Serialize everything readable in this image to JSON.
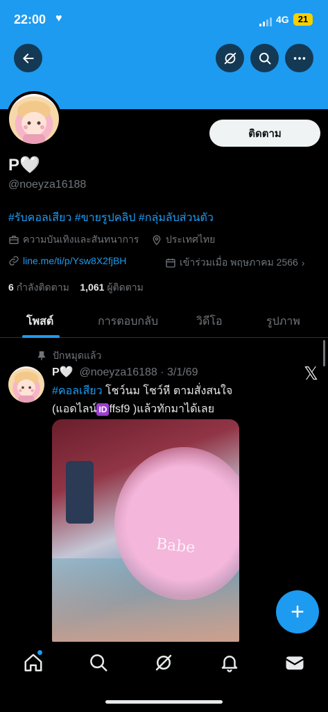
{
  "status_bar": {
    "time": "22:00",
    "network": "4G",
    "battery": "21"
  },
  "header": {
    "back_icon": "arrow-left-icon",
    "grok_icon": "grok-icon",
    "search_icon": "search-icon",
    "more_icon": "more-icon"
  },
  "profile": {
    "display_name": "P🤍",
    "handle": "@noeyza16188",
    "follow_label": "ติดตาม",
    "bio": "#รับคอลเสียว #ขายรูปคลิป #กลุ่มลับส่วนตัว",
    "category": "ความบันเทิงและสันทนาการ",
    "location": "ประเทศไทย",
    "link": "line.me/ti/p/Ysw8X2fjBH",
    "joined": "เข้าร่วมเมื่อ พฤษภาคม 2566",
    "following_count": "6",
    "following_label": "กำลังติดตาม",
    "followers_count": "1,061",
    "followers_label": "ผู้ติดตาม"
  },
  "tabs": [
    {
      "label": "โพสต์"
    },
    {
      "label": "การตอบกลับ"
    },
    {
      "label": "วิดีโอ"
    },
    {
      "label": "รูปภาพ"
    }
  ],
  "post": {
    "pinned_label": "ปักหมุดแล้ว",
    "name": "P🤍",
    "handle_date": "@noeyza16188 · 3/1/69",
    "hashtag": "#คอลเสียว",
    "line1_rest": " โชว์นม โชว์หี ตามสั่งสนใจ",
    "line2_a": "(แอดไลน์",
    "id_badge": "ID",
    "line2_b": "ffsf9 )แล้วทักมาได้เลย",
    "media_overlay": "Babe"
  },
  "fab": {
    "label": "+"
  },
  "colors": {
    "accent": "#1d9bf0",
    "background": "#000000",
    "text": "#e7e9ea",
    "muted": "#71767b"
  }
}
